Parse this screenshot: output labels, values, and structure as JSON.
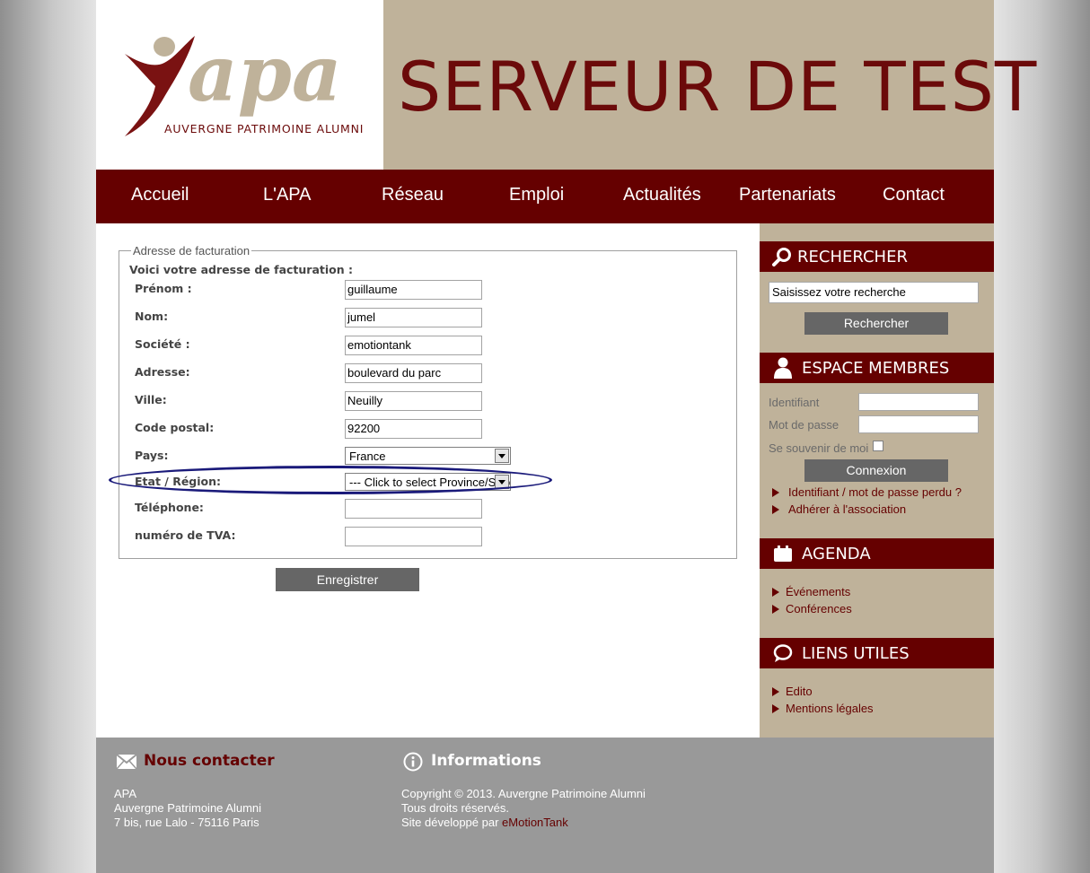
{
  "header": {
    "logo_text": "apa",
    "logo_subtitle": "AUVERGNE PATRIMOINE ALUMNI",
    "banner_title": "SERVEUR DE TEST"
  },
  "nav": {
    "items": [
      "Accueil",
      "L'APA",
      "Réseau",
      "Emploi",
      "Actualités",
      "Partenariats",
      "Contact"
    ]
  },
  "form": {
    "legend": "Adresse de facturation",
    "intro": "Voici votre adresse de facturation :",
    "fields": [
      {
        "label": "Prénom :",
        "value": "guillaume"
      },
      {
        "label": "Nom:",
        "value": "jumel"
      },
      {
        "label": "Société :",
        "value": "emotiontank"
      },
      {
        "label": "Adresse:",
        "value": "boulevard du parc"
      },
      {
        "label": "Ville:",
        "value": "Neuilly"
      },
      {
        "label": "Code postal:",
        "value": "92200"
      }
    ],
    "country_label": "Pays:",
    "country_value": "France",
    "region_label": "Etat / Région:",
    "region_value": "--- Click to select Province/State ---",
    "phone_label": "Téléphone:",
    "phone_value": "",
    "vat_label": "numéro de TVA:",
    "vat_value": "",
    "save_label": "Enregistrer"
  },
  "sidebar": {
    "search": {
      "title": "RECHERCHER",
      "placeholder": "Saisissez votre recherche",
      "button": "Rechercher"
    },
    "members": {
      "title": "ESPACE MEMBRES",
      "id_label": "Identifiant",
      "password_label": "Mot de passe",
      "remember_label": "Se souvenir de moi",
      "button": "Connexion",
      "links": [
        "Identifiant / mot de passe perdu ?",
        "Adhérer à l'association"
      ]
    },
    "agenda": {
      "title": "AGENDA",
      "links": [
        "Événements",
        "Conférences"
      ]
    },
    "useful_links": {
      "title": "LIENS UTILES",
      "links": [
        "Edito",
        "Mentions légales"
      ]
    }
  },
  "footer": {
    "contact": {
      "title": "Nous contacter",
      "lines": [
        "APA",
        "Auvergne Patrimoine Alumni",
        "7 bis, rue Lalo - 75116 Paris"
      ]
    },
    "info": {
      "title": "Informations",
      "lines": [
        "Copyright © 2013. Auvergne Patrimoine Alumni",
        "Tous droits réservés."
      ],
      "developer_prefix": "Site développé par ",
      "developer_link": "eMotionTank"
    }
  },
  "colors": {
    "brand_dark_red": "#650000",
    "beige": "#bfb29a",
    "button_gray": "#666666",
    "footer_gray": "#999999",
    "highlight_ellipse": "#1a1a7a"
  }
}
